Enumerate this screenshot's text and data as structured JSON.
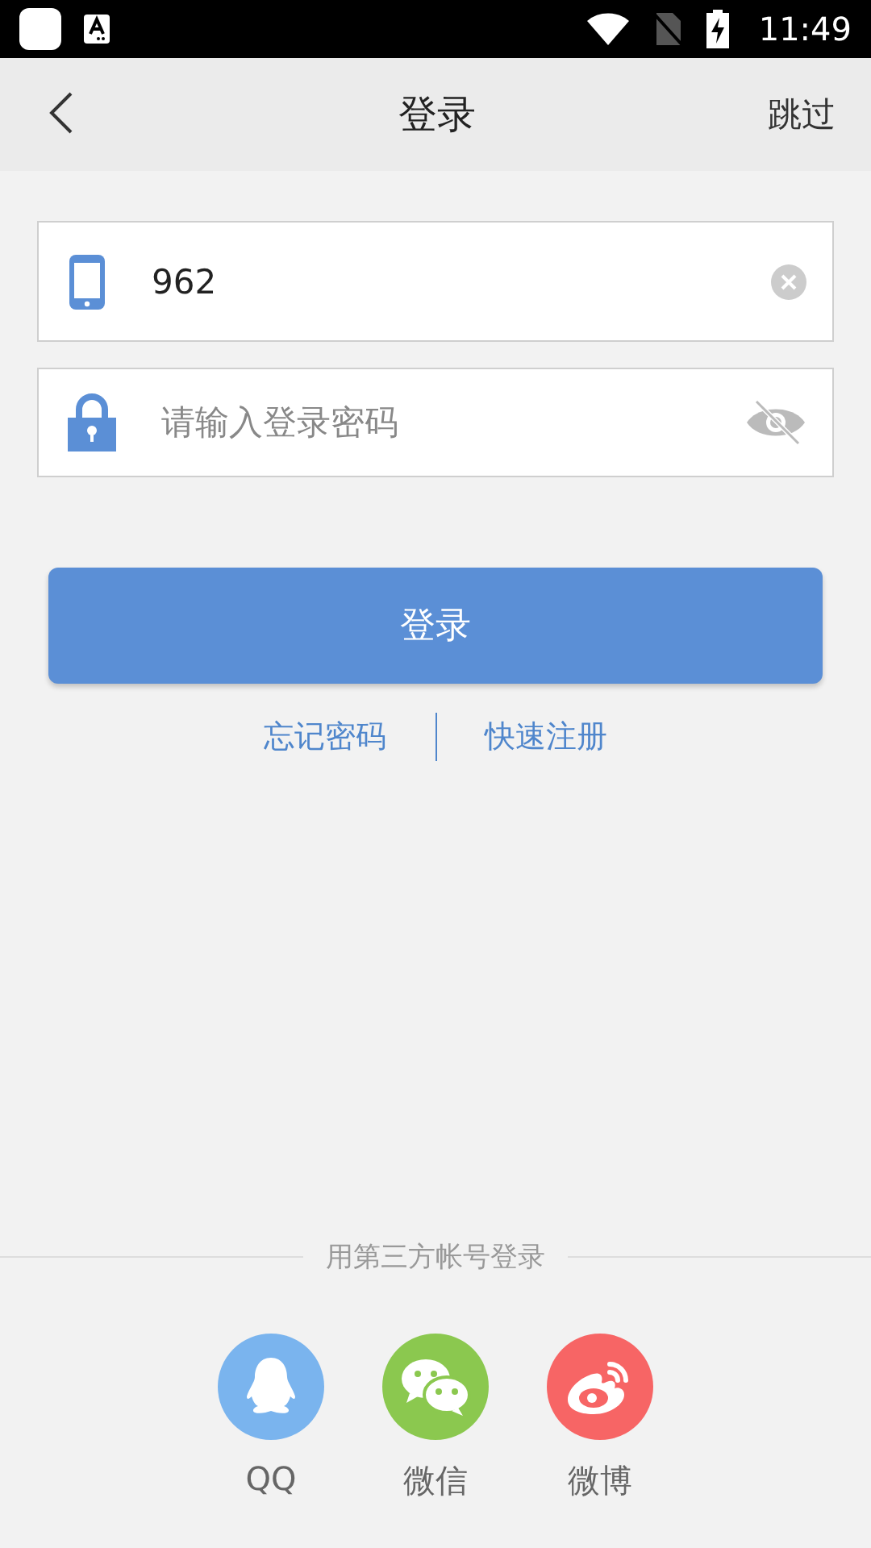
{
  "status_bar": {
    "time": "11:49"
  },
  "header": {
    "title": "登录",
    "action": "跳过"
  },
  "phone_field": {
    "value": "962"
  },
  "password_field": {
    "placeholder": "请输入登录密码"
  },
  "login_button": {
    "label": "登录"
  },
  "links": [
    "忘记密码",
    "快速注册"
  ],
  "third_party": {
    "label": "用第三方帐号登录",
    "options": [
      {
        "kind": "qq",
        "label": "QQ",
        "color": "#7ab4ee"
      },
      {
        "kind": "wechat",
        "label": "微信",
        "color": "#8bc84f"
      },
      {
        "kind": "weibo",
        "label": "微博",
        "color": "#f76565"
      }
    ]
  }
}
